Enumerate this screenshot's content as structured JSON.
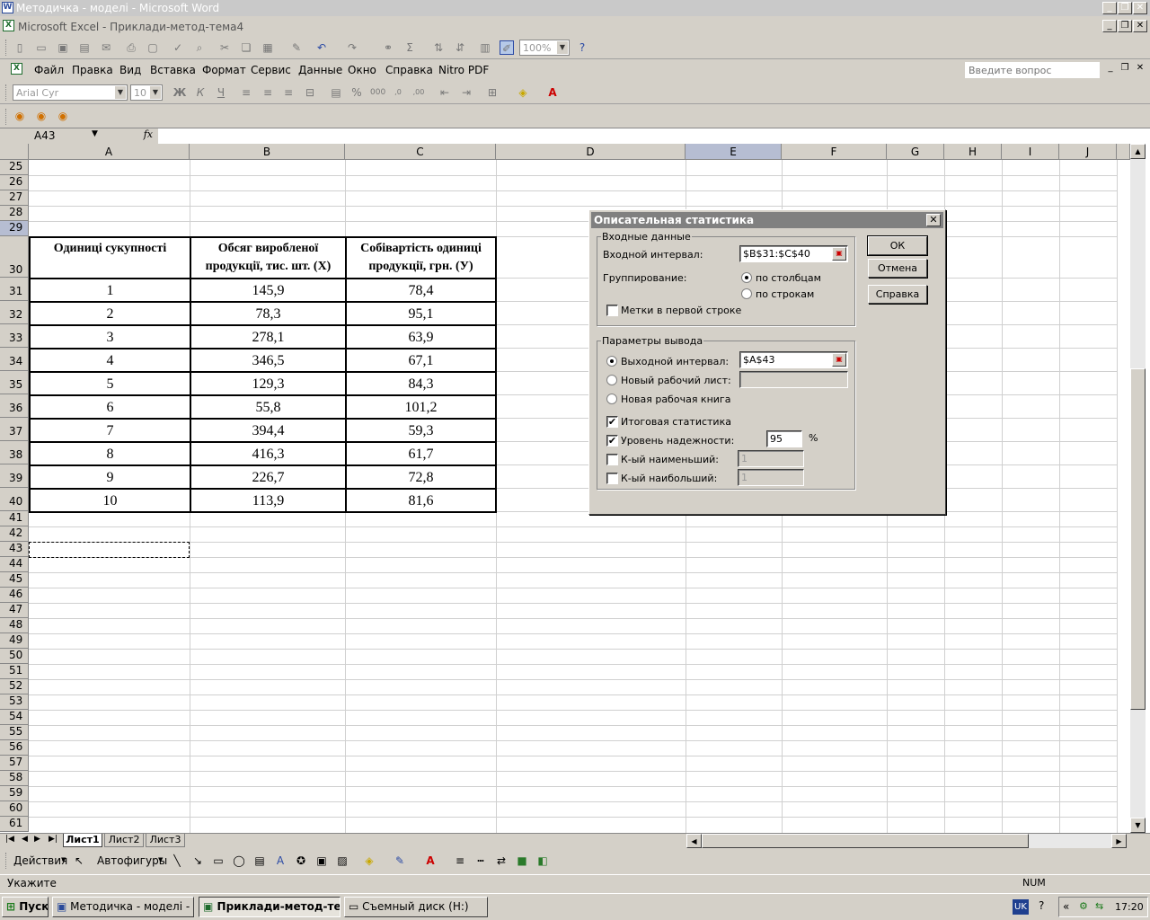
{
  "word_window": {
    "title": "Методичка - моделі - Microsoft Word"
  },
  "excel_window": {
    "title": "Microsoft Excel - Приклади-метод-тема4"
  },
  "toolbar": {
    "zoom": "100%"
  },
  "menu": {
    "items": [
      "Файл",
      "Правка",
      "Вид",
      "Вставка",
      "Формат",
      "Сервис",
      "Данные",
      "Окно",
      "Справка",
      "Nitro PDF"
    ],
    "help_search_placeholder": "Введите вопрос"
  },
  "format_bar": {
    "font": "Arial Cyr",
    "size": "10",
    "bold": "Ж",
    "italic": "К",
    "underline": "Ч"
  },
  "formula_bar": {
    "name_box": "A43",
    "fx": "fx",
    "formula": ""
  },
  "columns": [
    "A",
    "B",
    "C",
    "D",
    "E",
    "F",
    "G",
    "H",
    "I",
    "J"
  ],
  "rows_top": [
    "25",
    "26",
    "27",
    "28",
    "29"
  ],
  "rows_bottom": [
    "41",
    "42",
    "43",
    "44",
    "45",
    "46",
    "47",
    "48",
    "49",
    "50",
    "51",
    "52",
    "53",
    "54",
    "55",
    "56",
    "57",
    "58",
    "59",
    "60",
    "61"
  ],
  "table": {
    "header_row": "30",
    "headers": [
      "Одиниці сукупності",
      "Обсяг виробленої продукції, тис. шт. (Х)",
      "Собівартість одиниці продукції, грн. (У)"
    ],
    "rows": [
      {
        "row": "31",
        "n": "1",
        "x": "145,9",
        "y": "78,4"
      },
      {
        "row": "32",
        "n": "2",
        "x": "78,3",
        "y": "95,1"
      },
      {
        "row": "33",
        "n": "3",
        "x": "278,1",
        "y": "63,9"
      },
      {
        "row": "34",
        "n": "4",
        "x": "346,5",
        "y": "67,1"
      },
      {
        "row": "35",
        "n": "5",
        "x": "129,3",
        "y": "84,3"
      },
      {
        "row": "36",
        "n": "6",
        "x": "55,8",
        "y": "101,2"
      },
      {
        "row": "37",
        "n": "7",
        "x": "394,4",
        "y": "59,3"
      },
      {
        "row": "38",
        "n": "8",
        "x": "416,3",
        "y": "61,7"
      },
      {
        "row": "39",
        "n": "9",
        "x": "226,7",
        "y": "72,8"
      },
      {
        "row": "40",
        "n": "10",
        "x": "113,9",
        "y": "81,6"
      }
    ]
  },
  "dialog": {
    "title": "Описательная статистика",
    "input_group": "Входные данные",
    "input_range_label": "Входной интервал:",
    "input_range_value": "$B$31:$C$40",
    "grouping_label": "Группирование:",
    "by_columns": "по столбцам",
    "by_rows": "по строкам",
    "labels_first_row": "Метки в первой строке",
    "output_group": "Параметры вывода",
    "output_range_label": "Выходной интервал:",
    "output_range_value": "$A$43",
    "new_sheet": "Новый рабочий лист:",
    "new_book": "Новая рабочая книга",
    "summary_stats": "Итоговая статистика",
    "confidence_level": "Уровень надежности:",
    "confidence_value": "95",
    "percent": "%",
    "kth_smallest": "К-ый наименьший:",
    "kth_smallest_value": "1",
    "kth_largest": "К-ый наибольший:",
    "kth_largest_value": "1",
    "ok": "ОК",
    "cancel": "Отмена",
    "help": "Справка"
  },
  "sheets": [
    "Лист1",
    "Лист2",
    "Лист3"
  ],
  "draw_bar": {
    "actions": "Действия",
    "autoshapes": "Автофигуры"
  },
  "status": {
    "text": "Укажите",
    "num": "NUM"
  },
  "taskbar": {
    "start": "Пуск",
    "tasks": [
      "Методичка - моделі - Mi...",
      "Приклади-метод-те...",
      "Съемный диск (H:)"
    ],
    "lang": "UK",
    "time": "17:20"
  }
}
